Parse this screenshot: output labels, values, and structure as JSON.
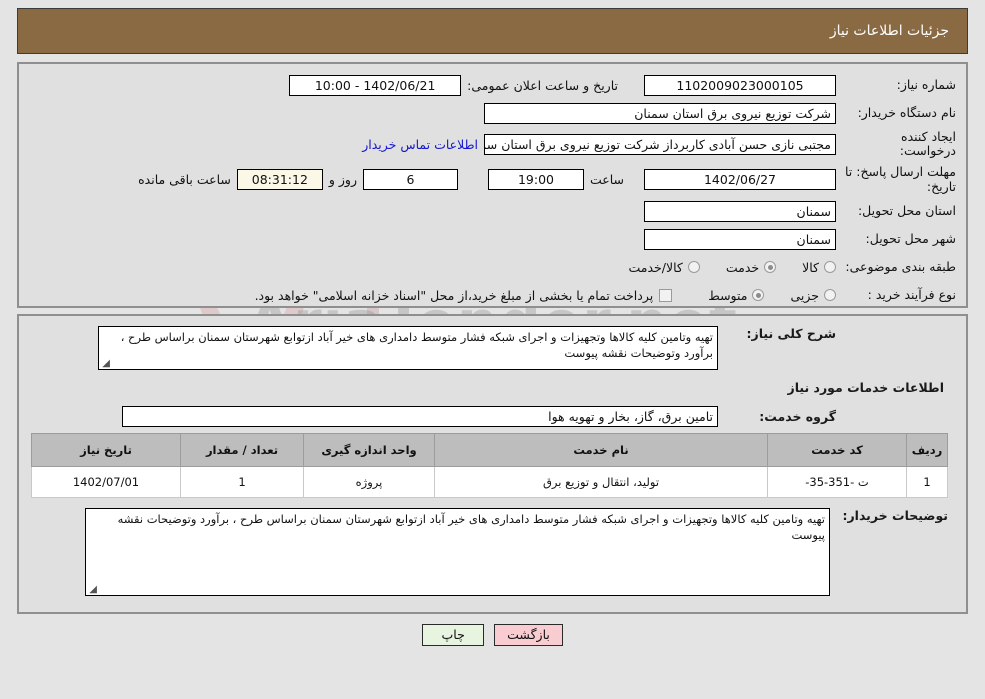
{
  "header": {
    "title": "جزئیات اطلاعات نیاز"
  },
  "form": {
    "need_number": {
      "label": "شماره نیاز:",
      "value": "1102009023000105"
    },
    "buyer_org": {
      "label": "نام دستگاه خریدار:",
      "value": "شرکت توزیع نیروی برق استان سمنان"
    },
    "requester": {
      "label": "ایجاد کننده درخواست:",
      "value": "مجتبی نازی حسن آبادی کاربرداز شرکت توزیع نیروی برق استان سمنان"
    },
    "contact_link": "اطلاعات تماس خریدار",
    "deadline": {
      "label": "مهلت ارسال پاسخ: تا تاریخ:",
      "value": "1402/06/27"
    },
    "deadline_time": {
      "label": "ساعت",
      "value": "19:00"
    },
    "deadline_days": {
      "label": "روز و",
      "value": "6"
    },
    "deadline_countdown": {
      "label": "ساعت باقی مانده",
      "value": "08:31:12"
    },
    "announce": {
      "label": "تاریخ و ساعت اعلان عمومی:",
      "value": "1402/06/21 - 10:00"
    },
    "province": {
      "label": "استان محل تحویل:",
      "value": "سمنان"
    },
    "city": {
      "label": "شهر محل تحویل:",
      "value": "سمنان"
    },
    "category": {
      "label": "طبقه بندی موضوعی:",
      "options": [
        {
          "label": "کالا",
          "selected": false
        },
        {
          "label": "خدمت",
          "selected": true
        },
        {
          "label": "کالا/خدمت",
          "selected": false
        }
      ]
    },
    "process_type": {
      "label": "نوع فرآیند خرید :",
      "options": [
        {
          "label": "جزیی",
          "selected": false
        },
        {
          "label": "متوسط",
          "selected": true
        }
      ]
    },
    "treasury_note": {
      "checked": false,
      "text": "پرداخت تمام یا بخشی از مبلغ خرید،از محل \"اسناد خزانه اسلامی\" خواهد بود."
    }
  },
  "description": {
    "label": "شرح کلی نیاز:",
    "value": "تهیه وتامین کلیه کالاها وتجهیزات و اجرای شبکه فشار متوسط دامداری های خیر آباد ازتوابع شهرستان سمنان براساس طرح ، برآورد وتوضیحات نقشه پیوست"
  },
  "services_section": {
    "title": "اطلاعات خدمات مورد نیاز",
    "group": {
      "label": "گروه خدمت:",
      "value": "تامین برق، گاز، بخار و تهویه هوا"
    }
  },
  "table": {
    "columns": [
      "ردیف",
      "کد خدمت",
      "نام خدمت",
      "واحد اندازه گیری",
      "تعداد / مقدار",
      "تاریخ نیاز"
    ],
    "rows": [
      {
        "radif": "1",
        "code": "ت -351-35-",
        "name": "تولید، انتقال و توزیع برق",
        "unit": "پروژه",
        "qty": "1",
        "date": "1402/07/01"
      }
    ]
  },
  "buyer_notes": {
    "label": "توضیحات خریدار:",
    "value": "تهیه وتامین کلیه کالاها وتجهیزات و اجرای شبکه فشار متوسط دامداری های خیر آباد ازتوابع شهرستان سمنان براساس طرح ، برآورد وتوضیحات نقشه پیوست"
  },
  "footer": {
    "back_label": "بازگشت",
    "print_label": "چاپ"
  },
  "watermark": {
    "text": "AriaTender.net"
  },
  "colors": {
    "header_bar": "#8a6a43",
    "page_bg": "#e4e4e4",
    "panel_bg": "#e0e0e0",
    "link": "#1515cf",
    "countdown_bg": "#fbf8e8",
    "btn_back": "#f8ccd0",
    "btn_print": "#e7f4e0",
    "table_header": "#bdbdbd"
  }
}
